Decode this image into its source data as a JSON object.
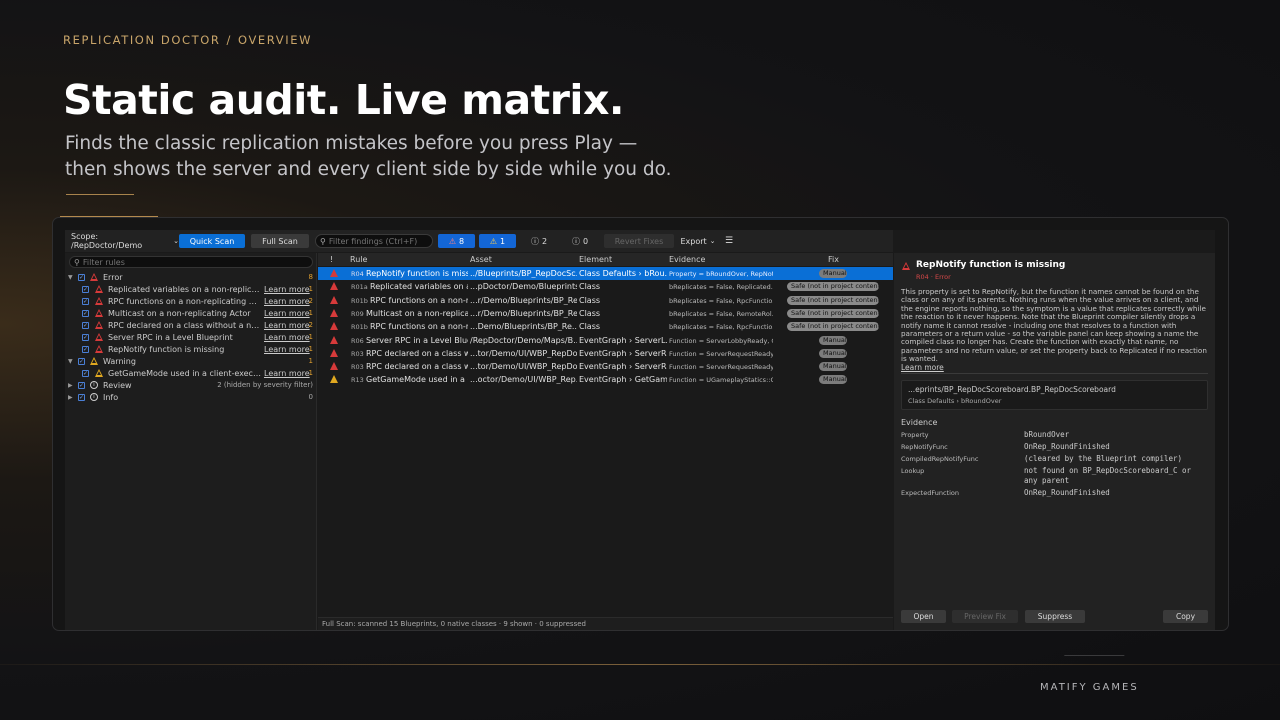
{
  "breadcrumb": {
    "app": "REPLICATION DOCTOR",
    "sep": "/",
    "page": "OVERVIEW"
  },
  "hero": {
    "title": "Static audit. Live matrix.",
    "line1": "Finds the classic replication mistakes before you press Play —",
    "line2": "then shows the server and every client side by side while you do."
  },
  "footer": {
    "brand": "MATIFY GAMES"
  },
  "toolbar": {
    "scope": "Scope: /RepDoctor/Demo",
    "quick_scan": "Quick Scan",
    "full_scan": "Full Scan",
    "search_placeholder": "Filter findings (Ctrl+F)",
    "errors": "8",
    "warnings": "1",
    "review": "2",
    "info": "0",
    "revert": "Revert Fixes",
    "export": "Export"
  },
  "rules": {
    "search_placeholder": "Filter rules",
    "learn": "Learn more",
    "error_group": {
      "label": "Error",
      "count": "8"
    },
    "error_items": [
      {
        "label": "Replicated variables on a non-replicating A...",
        "count": "1"
      },
      {
        "label": "RPC functions on a non-replicating Actor",
        "count": "2"
      },
      {
        "label": "Multicast on a non-replicating Actor",
        "count": "1"
      },
      {
        "label": "RPC declared on a class without a network...",
        "count": "2"
      },
      {
        "label": "Server RPC in a Level Blueprint",
        "count": "1"
      },
      {
        "label": "RepNotify function is missing",
        "count": "1"
      }
    ],
    "warning_group": {
      "label": "Warning",
      "count": "1"
    },
    "warning_items": [
      {
        "label": "GetGameMode used in a client-executing...",
        "count": "1"
      }
    ],
    "review_group": {
      "label": "Review",
      "count": "2 (hidden by severity filter)"
    },
    "info_group": {
      "label": "Info",
      "count": "0"
    }
  },
  "findings": {
    "headers": {
      "sev": "!",
      "rule": "Rule",
      "asset": "Asset",
      "element": "Element",
      "evidence": "Evidence",
      "fix": "Fix"
    },
    "rows": [
      {
        "sev": "error",
        "id": "R04",
        "rule": "RepNotify function is missing",
        "asset": "../Blueprints/BP_RepDocSc...",
        "element": "Class Defaults › bRou...",
        "evidence": "Property = bRoundOver, RepNoti...",
        "fix": "Manual",
        "fix_type": "manual"
      },
      {
        "sev": "error",
        "id": "R01a",
        "rule": "Replicated variables on a...",
        "asset": "...pDoctor/Demo/Blueprints...",
        "element": "Class",
        "evidence": "bReplicates = False, Replicated...",
        "fix": "Safe (not in project content)",
        "fix_type": "safe"
      },
      {
        "sev": "error",
        "id": "R01b",
        "rule": "RPC functions on a non-re...",
        "asset": "...r/Demo/Blueprints/BP_Re...",
        "element": "Class",
        "evidence": "bReplicates = False, RpcFunctio...",
        "fix": "Safe (not in project content)",
        "fix_type": "safe"
      },
      {
        "sev": "error",
        "id": "R09",
        "rule": "Multicast on a non-replicati...",
        "asset": "...r/Demo/Blueprints/BP_Re...",
        "element": "Class",
        "evidence": "bReplicates = False, RemoteRol...",
        "fix": "Safe (not in project content)",
        "fix_type": "safe"
      },
      {
        "sev": "error",
        "id": "R01b",
        "rule": "RPC functions on a non-re...",
        "asset": "...Demo/Blueprints/BP_Re...",
        "element": "Class",
        "evidence": "bReplicates = False, RpcFunctio...",
        "fix": "Safe (not in project content)",
        "fix_type": "safe"
      },
      {
        "sev": "error",
        "id": "R06",
        "rule": "Server RPC in a Level Blue...",
        "asset": "/RepDoctor/Demo/Maps/B...",
        "element": "EventGraph › ServerL...",
        "evidence": "Function = ServerLobbyReady, C...",
        "fix": "Manual",
        "fix_type": "manual"
      },
      {
        "sev": "error",
        "id": "R03",
        "rule": "RPC declared on a class wi...",
        "asset": "...tor/Demo/UI/WBP_RepDo...",
        "element": "EventGraph › ServerR...",
        "evidence": "Function = ServerRequestReady...",
        "fix": "Manual",
        "fix_type": "manual"
      },
      {
        "sev": "error",
        "id": "R03",
        "rule": "RPC declared on a class wi...",
        "asset": "...tor/Demo/UI/WBP_RepDo...",
        "element": "EventGraph › ServerR...",
        "evidence": "Function = ServerRequestReady...",
        "fix": "Manual",
        "fix_type": "manual"
      },
      {
        "sev": "warning",
        "id": "R13",
        "rule": "GetGameMode used in a cli...",
        "asset": "...octor/Demo/UI/WBP_Rep...",
        "element": "EventGraph › GetGam...",
        "evidence": "Function = UGameplayStatics::G...",
        "fix": "Manual",
        "fix_type": "manual"
      }
    ],
    "status": "Full Scan: scanned 15 Blueprints, 0 native classes · 9 shown · 0 suppressed"
  },
  "detail": {
    "title": "RepNotify function is missing",
    "subtitle": "R04 · Error",
    "body": "This property is set to RepNotify, but the function it names cannot be found on the class or on any of its parents. Nothing runs when the value arrives on a client, and the engine reports nothing, so the symptom is a value that replicates correctly while the reaction to it never happens. Note that the Blueprint compiler silently drops a notify name it cannot resolve - including one that resolves to a function with parameters or a return value - so the variable panel can keep showing a name the compiled class no longer has. Create the function with exactly that name, no parameters and no return value, or set the property back to Replicated if no reaction is wanted.",
    "learn": "Learn more",
    "path": "...eprints/BP_RepDocScoreboard.BP_RepDocScoreboard",
    "path_sub": "Class Defaults › bRoundOver",
    "evidence_title": "Evidence",
    "evidence": [
      {
        "key": "Property",
        "value": "bRoundOver"
      },
      {
        "key": "RepNotifyFunc",
        "value": "OnRep_RoundFinished"
      },
      {
        "key": "CompiledRepNotifyFunc",
        "value": "(cleared by the Blueprint compiler)"
      },
      {
        "key": "Lookup",
        "value": "not found on BP_RepDocScoreboard_C or any parent"
      },
      {
        "key": "ExpectedFunction",
        "value": "OnRep_RoundFinished"
      }
    ],
    "buttons": {
      "open": "Open",
      "preview": "Preview Fix",
      "suppress": "Suppress",
      "copy": "Copy"
    }
  }
}
